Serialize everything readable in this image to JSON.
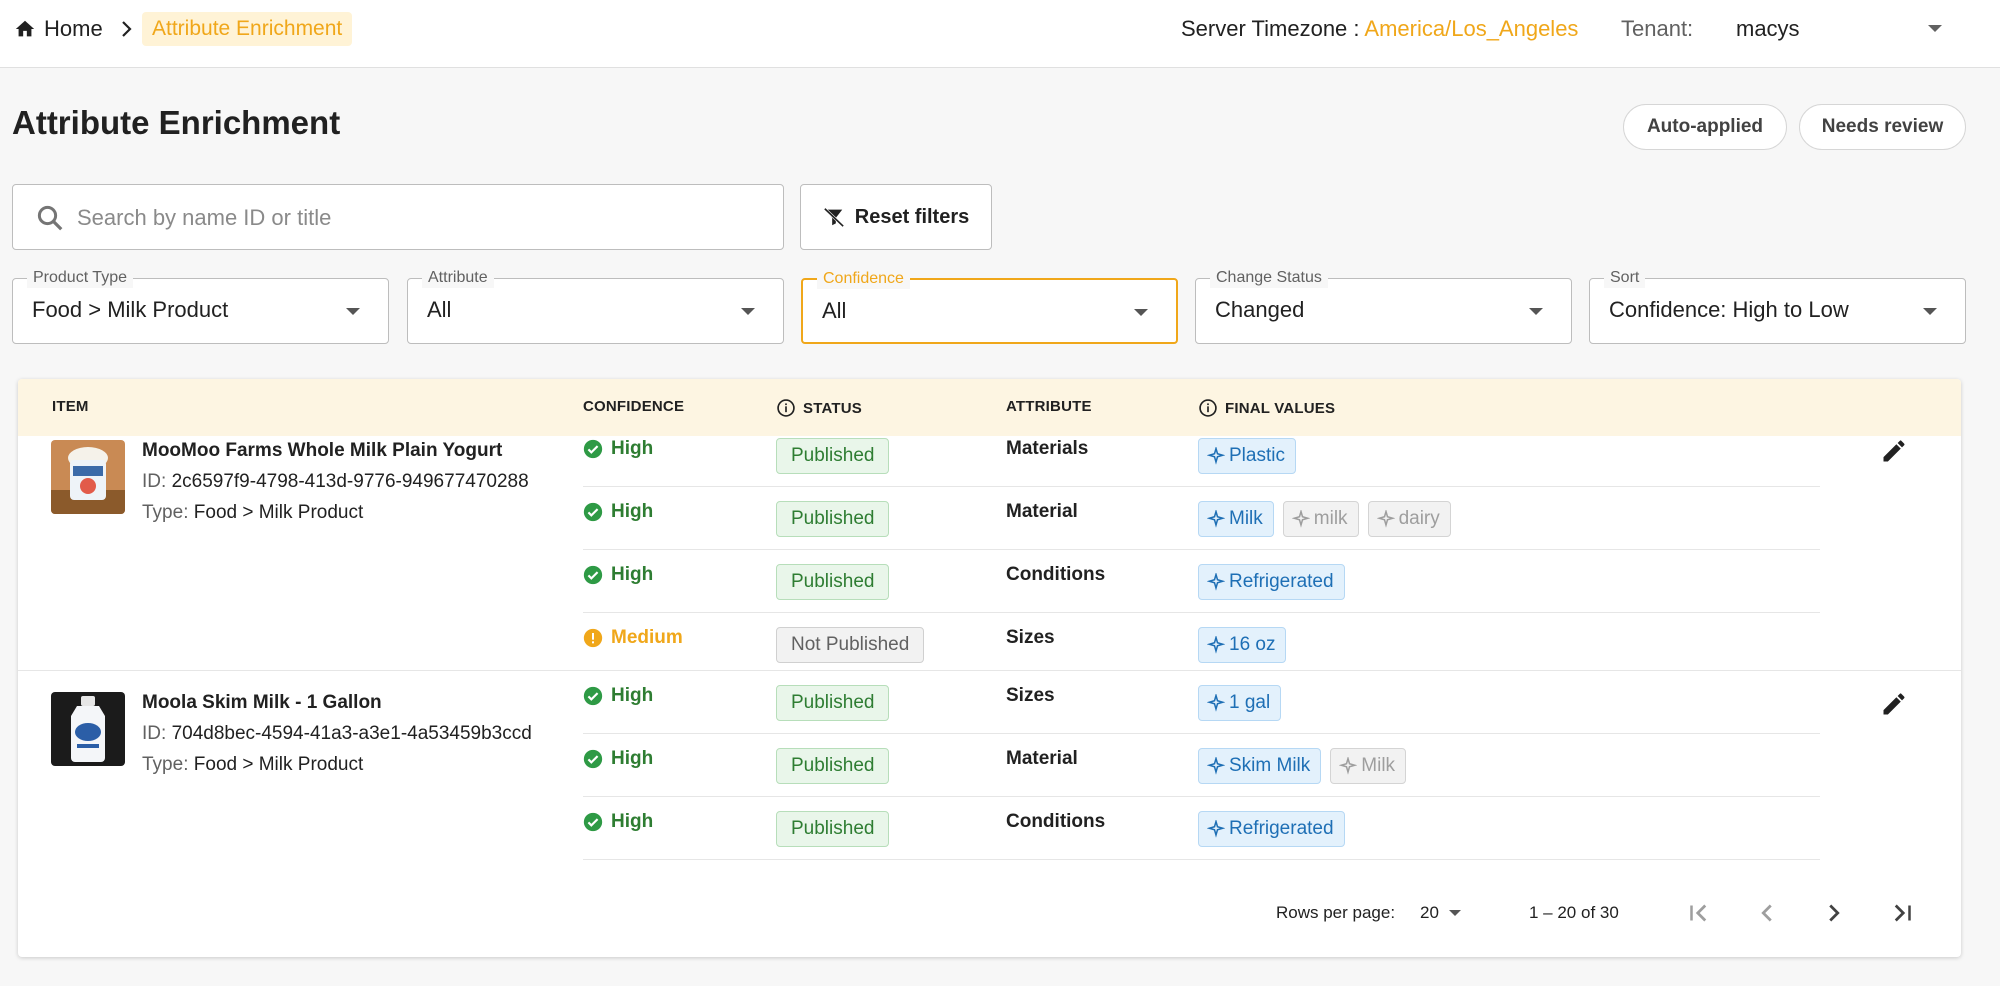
{
  "breadcrumb": {
    "home": "Home",
    "current": "Attribute Enrichment"
  },
  "server": {
    "timezone_label": "Server Timezone :",
    "timezone_value": "America/Los_Angeles"
  },
  "tenant": {
    "label": "Tenant:",
    "value": "macys"
  },
  "page": {
    "title": "Attribute Enrichment"
  },
  "review_buttons": {
    "auto_applied": "Auto-applied",
    "needs_review": "Needs review"
  },
  "search": {
    "placeholder": "Search by name ID or title",
    "value": ""
  },
  "reset_filters": "Reset filters",
  "filters": [
    {
      "label": "Product Type",
      "value": "Food > Milk Product",
      "active": false
    },
    {
      "label": "Attribute",
      "value": "All",
      "active": false
    },
    {
      "label": "Confidence",
      "value": "All",
      "active": true
    },
    {
      "label": "Change Status",
      "value": "Changed",
      "active": false
    },
    {
      "label": "Sort",
      "value": "Confidence: High to Low",
      "active": false
    }
  ],
  "table": {
    "headers": {
      "item": "ITEM",
      "confidence": "CONFIDENCE",
      "status": "STATUS",
      "attribute": "ATTRIBUTE",
      "final_values": "FINAL VALUES"
    },
    "products": [
      {
        "name": "MooMoo Farms Whole Milk Plain Yogurt",
        "id_label": "ID:",
        "id": "2c6597f9-4798-413d-9776-949677470288",
        "type_label": "Type:",
        "type": "Food > Milk Product",
        "attributes": [
          {
            "confidence": "High",
            "status": "Published",
            "attribute": "Materials",
            "values": [
              {
                "text": "Plastic",
                "selected": true
              }
            ]
          },
          {
            "confidence": "High",
            "status": "Published",
            "attribute": "Material",
            "values": [
              {
                "text": "Milk",
                "selected": true
              },
              {
                "text": "milk",
                "selected": false
              },
              {
                "text": "dairy",
                "selected": false
              }
            ]
          },
          {
            "confidence": "High",
            "status": "Published",
            "attribute": "Conditions",
            "values": [
              {
                "text": "Refrigerated",
                "selected": true
              }
            ]
          },
          {
            "confidence": "Medium",
            "status": "Not Published",
            "attribute": "Sizes",
            "values": [
              {
                "text": "16 oz",
                "selected": true
              }
            ]
          }
        ]
      },
      {
        "name": "Moola Skim Milk - 1 Gallon",
        "id_label": "ID:",
        "id": "704d8bec-4594-41a3-a3e1-4a53459b3ccd",
        "type_label": "Type:",
        "type": "Food > Milk Product",
        "attributes": [
          {
            "confidence": "High",
            "status": "Published",
            "attribute": "Sizes",
            "values": [
              {
                "text": "1 gal",
                "selected": true
              }
            ]
          },
          {
            "confidence": "High",
            "status": "Published",
            "attribute": "Material",
            "values": [
              {
                "text": "Skim Milk",
                "selected": true
              },
              {
                "text": "Milk",
                "selected": false
              }
            ]
          },
          {
            "confidence": "High",
            "status": "Published",
            "attribute": "Conditions",
            "values": [
              {
                "text": "Refrigerated",
                "selected": true
              }
            ]
          }
        ]
      }
    ]
  },
  "pagination": {
    "rows_per_page_label": "Rows per page:",
    "rows_per_page": "20",
    "range": "1 – 20 of 30"
  },
  "colors": {
    "accent": "#f0a71a",
    "success": "#2e7d32",
    "chip_blue": "#1e6fb5"
  },
  "icons": [
    "home-icon",
    "chevron-right-icon",
    "search-icon",
    "filter-off-icon",
    "info-icon",
    "check-circle-icon",
    "warning-circle-icon",
    "sparkle-icon",
    "edit-icon",
    "first-page-icon",
    "prev-page-icon",
    "next-page-icon",
    "last-page-icon"
  ]
}
